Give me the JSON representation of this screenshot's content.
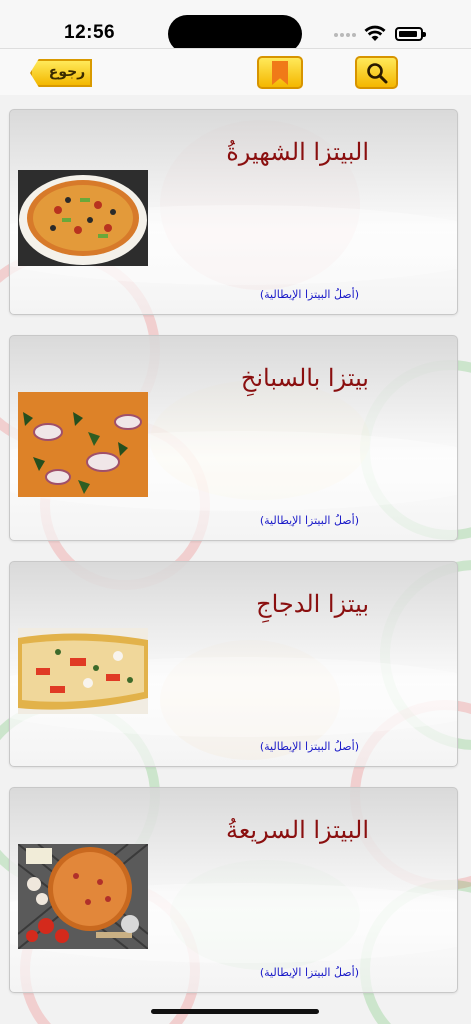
{
  "status_bar": {
    "time": "12:56"
  },
  "nav": {
    "back_label": "رجوع"
  },
  "items": [
    {
      "title": "البيتزا الشهيرةُ",
      "subtitle": "(أصلُ البيتزا الإيطالية)"
    },
    {
      "title": "بيتزا بالسبانخِ",
      "subtitle": "(أصلُ البيتزا الإيطالية)"
    },
    {
      "title": "بيتزا الدجاجِ",
      "subtitle": "(أصلُ البيتزا الإيطالية)"
    },
    {
      "title": "البيتزا السريعةُ",
      "subtitle": "(أصلُ البيتزا الإيطالية)"
    }
  ],
  "colors": {
    "title": "#8a0f0f",
    "subtitle": "#1919c8",
    "button": "#f7c600",
    "bookmark": "#f07a18"
  }
}
